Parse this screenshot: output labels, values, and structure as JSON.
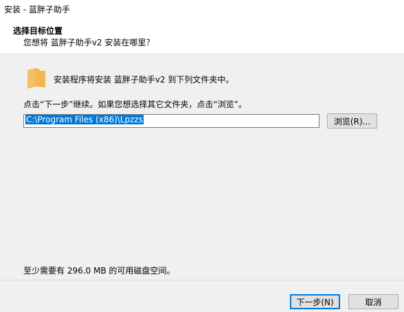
{
  "window": {
    "title": "安装 - 蓝胖子助手"
  },
  "header": {
    "title": "选择目标位置",
    "subtitle": "您想将 蓝胖子助手v2 安装在哪里？"
  },
  "content": {
    "install_line": "安装程序将安装 蓝胖子助手v2 到下列文件夹中。",
    "instruction": "点击“下一步”继续。如果您想选择其它文件夹，点击“浏览”。",
    "path_value": "C:\\Program Files (x86)\\Lpzzs",
    "browse_label": "浏览(R)...",
    "space_text": "至少需要有 296.0 MB 的可用磁盘空间。"
  },
  "footer": {
    "next_label": "下一步(N)",
    "cancel_label": "取消"
  },
  "icons": {
    "folder": "folder-icon"
  },
  "colors": {
    "selection": "#0078d7",
    "folder": "#f2b64b"
  }
}
